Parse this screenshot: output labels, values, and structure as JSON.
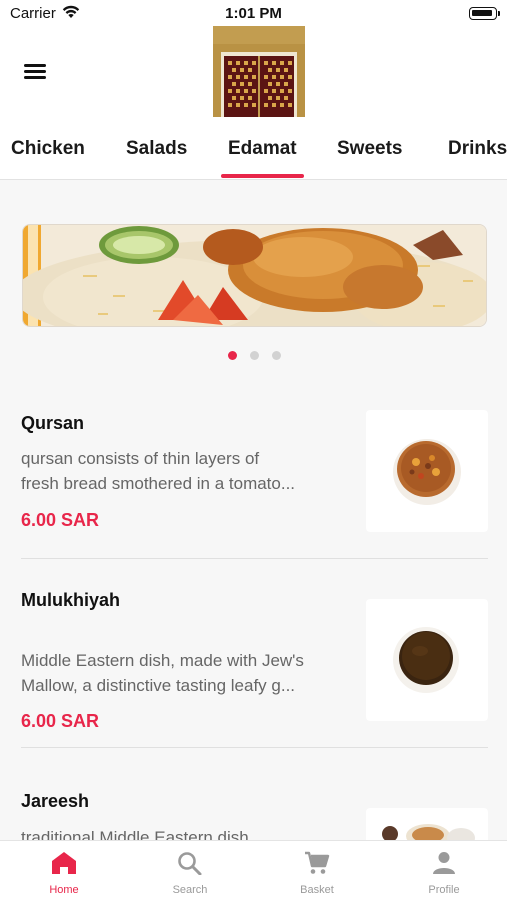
{
  "status_bar": {
    "carrier": "Carrier",
    "time": "1:01 PM"
  },
  "tabs": [
    {
      "label": "Chicken",
      "active": false
    },
    {
      "label": "Salads",
      "active": false
    },
    {
      "label": "Edamat",
      "active": true
    },
    {
      "label": "Sweets",
      "active": false
    },
    {
      "label": "Drinks",
      "active": false
    }
  ],
  "banner": {
    "slide_count": 3,
    "active_slide": 1
  },
  "items": [
    {
      "name": "Qursan",
      "desc_line1": "qursan consists of thin layers of",
      "desc_line2": "fresh bread smothered in a tomato...",
      "price": "6.00 SAR"
    },
    {
      "name": "Mulukhiyah",
      "desc_line1": "Middle Eastern dish, made with Jew's",
      "desc_line2": "Mallow, a distinctive tasting leafy g...",
      "price": "6.00 SAR"
    },
    {
      "name": "Jareesh",
      "desc_line1": " traditional Middle Eastern dish",
      "desc_line2": "",
      "price": ""
    }
  ],
  "bottom_nav": [
    {
      "label": "Home",
      "icon": "home-icon",
      "active": true
    },
    {
      "label": "Search",
      "icon": "search-icon",
      "active": false
    },
    {
      "label": "Basket",
      "icon": "cart-icon",
      "active": false
    },
    {
      "label": "Profile",
      "icon": "profile-icon",
      "active": false
    }
  ],
  "colors": {
    "accent": "#e8264a",
    "text": "#111111",
    "muted": "#666666",
    "background": "#f7f7f7"
  }
}
